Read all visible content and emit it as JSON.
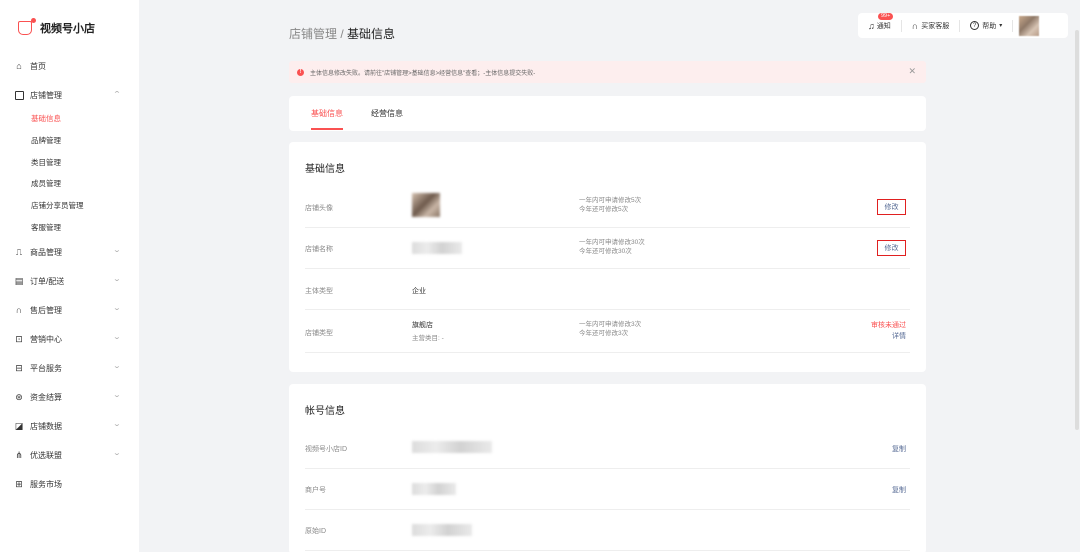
{
  "app": {
    "name": "视频号小店"
  },
  "sidebar": {
    "home": "首页",
    "store": {
      "label": "店铺管理",
      "items": [
        "基础信息",
        "品牌管理",
        "类目管理",
        "成员管理",
        "店铺分享员管理",
        "客服管理"
      ]
    },
    "menu": [
      {
        "label": "商品管理",
        "icon": "bag-icon"
      },
      {
        "label": "订单/配送",
        "icon": "clipboard-icon"
      },
      {
        "label": "售后管理",
        "icon": "headset-icon"
      },
      {
        "label": "营销中心",
        "icon": "ticket-icon"
      },
      {
        "label": "平台服务",
        "icon": "briefcase-icon"
      },
      {
        "label": "资金结算",
        "icon": "coin-icon"
      },
      {
        "label": "店铺数据",
        "icon": "chart-icon"
      },
      {
        "label": "优选联盟",
        "icon": "network-icon"
      },
      {
        "label": "服务市场",
        "icon": "grid-icon"
      }
    ]
  },
  "header": {
    "breadcrumb_parent": "店铺管理",
    "breadcrumb_sep": " / ",
    "breadcrumb_current": "基础信息",
    "notify_label": "通知",
    "notify_badge": "99+",
    "service_label": "买家客服",
    "help_label": "帮助"
  },
  "alert": {
    "text": "主体信息修改失败。请前往\"店铺管理>基础信息>经营信息\"查看；-主体信息提交失败-"
  },
  "tabs": [
    "基础信息",
    "经营信息"
  ],
  "basic": {
    "title": "基础信息",
    "rows": {
      "avatar": {
        "label": "店铺头像",
        "hint1": "一年内可申请修改5次",
        "hint2": "今年还可修改5次",
        "action": "修改"
      },
      "name": {
        "label": "店铺名称",
        "hint1": "一年内可申请修改30次",
        "hint2": "今年还可修改30次",
        "action": "修改"
      },
      "entity": {
        "label": "主体类型",
        "value": "企业"
      },
      "type": {
        "label": "店铺类型",
        "value": "旗舰店",
        "sub": "主营类目: -",
        "hint1": "一年内可申请修改3次",
        "hint2": "今年还可修改3次",
        "status": "审核未通过",
        "detail": "详情"
      }
    }
  },
  "account": {
    "title": "帐号信息",
    "rows": {
      "shop_id": {
        "label": "视频号小店ID",
        "action": "复制"
      },
      "merchant": {
        "label": "商户号",
        "action": "复制"
      },
      "original": {
        "label": "原始ID"
      }
    }
  },
  "colors": {
    "accent": "#fa5151",
    "link": "#576b95",
    "highlight_border": "#e02020"
  }
}
